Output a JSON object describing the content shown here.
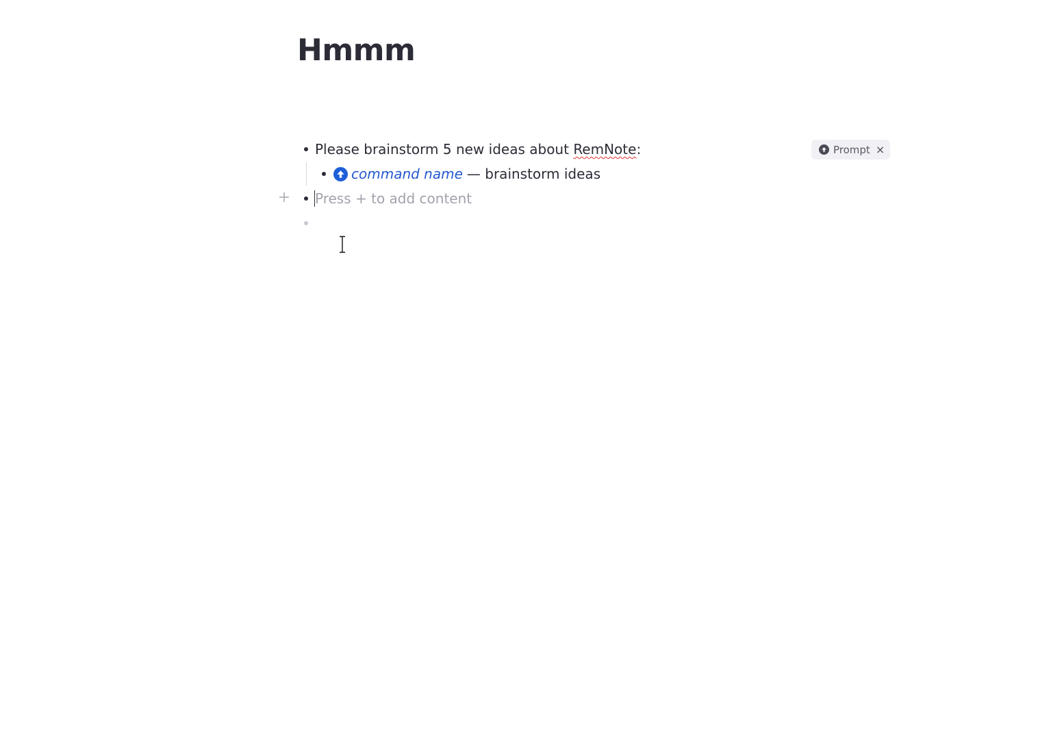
{
  "document": {
    "title": "Hmmm"
  },
  "rems": [
    {
      "text_before": "Please brainstorm 5 new ideas about ",
      "text_misspelled": "RemNote",
      "text_after": ":",
      "tag": {
        "icon": "arrow-up-circle-icon",
        "label": "Prompt",
        "close": "×"
      },
      "children": [
        {
          "icon": "arrow-up-circle-icon",
          "command_name": "command name",
          "rest": "— brainstorm ideas"
        }
      ]
    },
    {
      "placeholder": "Press + to add content"
    }
  ],
  "add_button": {
    "label": "+"
  },
  "colors": {
    "accent": "#1e5fd9",
    "text": "#2b2c36",
    "placeholder": "#a2a2ad",
    "spellcheck": "#e03030"
  }
}
